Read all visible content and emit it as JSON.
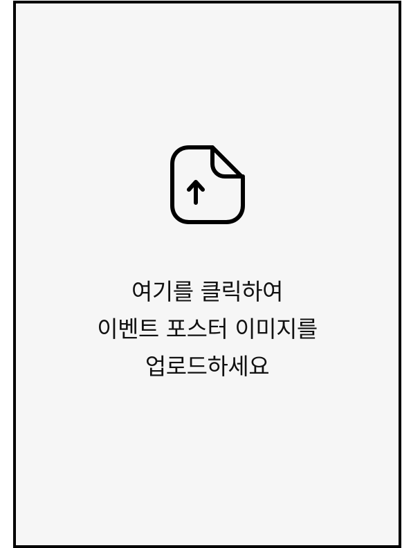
{
  "upload": {
    "icon": "file-upload-icon",
    "lines": [
      "여기를 클릭하여",
      "이벤트 포스터 이미지를",
      "업로드하세요"
    ]
  },
  "colors": {
    "border": "#000000",
    "background": "#f6f6f6",
    "text": "#111111"
  }
}
